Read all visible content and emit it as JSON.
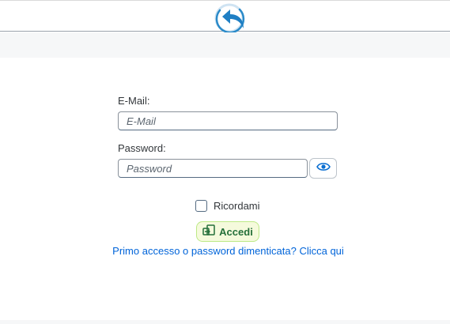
{
  "header": {
    "logo_icon": "back-arrow-circle-logo-icon",
    "accent_color": "#2a8ac9"
  },
  "form": {
    "email": {
      "label": "E-Mail:",
      "placeholder": "E-Mail",
      "value": ""
    },
    "password": {
      "label": "Password:",
      "placeholder": "Password",
      "value": "",
      "toggle_icon": "eye-icon"
    },
    "remember": {
      "label": "Ricordami",
      "checked": false
    },
    "login_button": {
      "label": "Accedi",
      "icon": "login-icon",
      "color": "#256f3a",
      "background": "#f5fadc"
    },
    "first_access_link": {
      "label": "Primo accesso o password dimenticata? Clicca qui",
      "color": "#0064d9"
    }
  }
}
